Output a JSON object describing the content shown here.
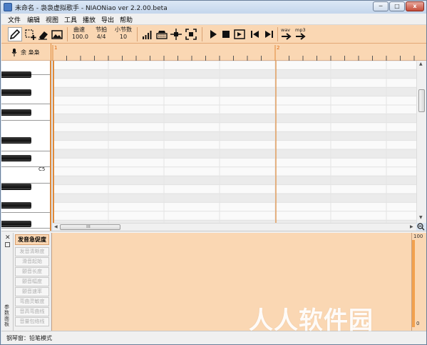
{
  "window": {
    "title": "未命名 - 袅袅虚拟歌手 - NIAONiao ver 2.2.00.beta",
    "min_glyph": "─",
    "max_glyph": "□",
    "close_glyph": "x"
  },
  "menu": [
    "文件",
    "编辑",
    "视图",
    "工具",
    "播放",
    "导出",
    "帮助"
  ],
  "toolbar": {
    "tools": [
      "pencil-icon",
      "select-add-icon",
      "eraser-icon",
      "image-icon"
    ],
    "tempo": {
      "label": "曲速",
      "value": "100.0"
    },
    "beat": {
      "label": "节拍",
      "value": "4/4"
    },
    "measures": {
      "label": "小节数",
      "value": "10"
    },
    "view_tools": [
      "volume-bars-icon",
      "keyboard-icon",
      "move-cross-icon",
      "fit-view-icon"
    ],
    "transport": [
      "play-icon",
      "stop-icon",
      "play-from-cursor-icon",
      "skip-start-icon",
      "skip-end-icon"
    ],
    "export_wav_label": "wav",
    "export_mp3_label": "mp3"
  },
  "track": {
    "name": "余 枭枭",
    "ruler_bars": [
      "1",
      "2"
    ]
  },
  "piano": {
    "c5_label": "C5"
  },
  "hscroll": {
    "grip": "ııı"
  },
  "param_panel": {
    "side_label": "参数面板",
    "close_glyph": "✕",
    "params": [
      "发音急促度",
      "发音清晰度",
      "滑音起始",
      "颤音长度",
      "颤音幅度",
      "颤音速率",
      "弯曲灵敏度",
      "音高弯曲线",
      "音量包络线"
    ],
    "selected_index": 0,
    "scale_top": "100",
    "scale_bottom": "0"
  },
  "status": {
    "text": "钢琴窗：铅笔模式"
  },
  "watermark": "人人软件园",
  "colors": {
    "accent": "#fad7b3",
    "playhead": "#e08a3a",
    "grid_dark": "#ebebeb",
    "grid_light": "#fafafa"
  }
}
